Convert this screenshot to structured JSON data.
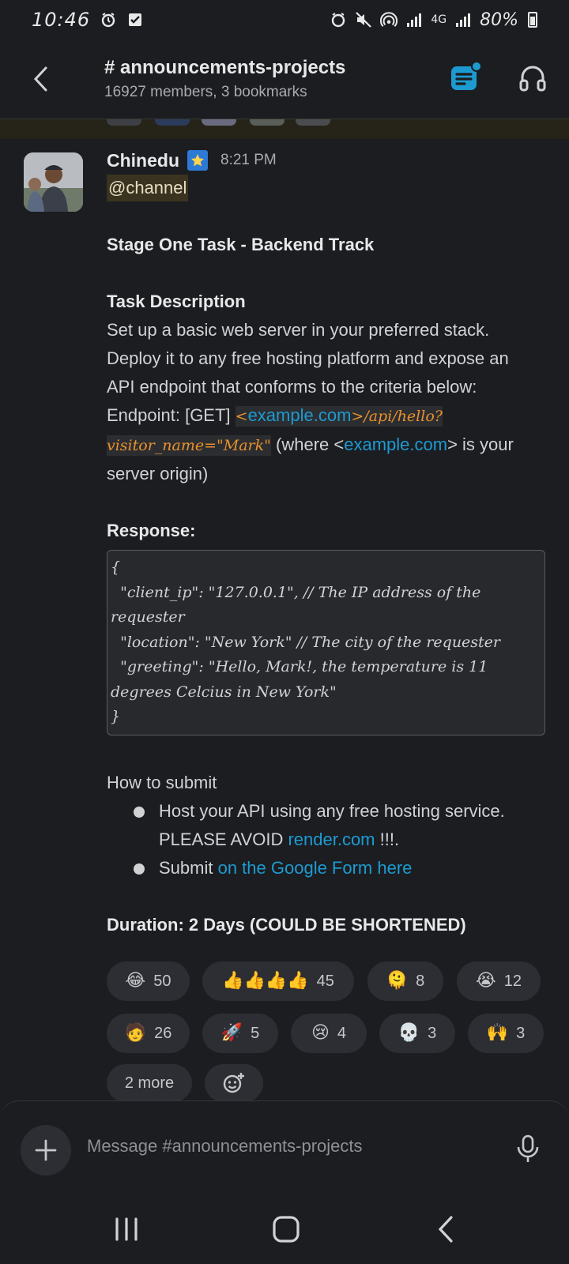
{
  "status_bar": {
    "time": "10:46",
    "battery": "80%",
    "network": "4G"
  },
  "header": {
    "title": "# announcements-projects",
    "subtitle": "16927 members, 3 bookmarks"
  },
  "message": {
    "author": "Chinedu",
    "time": "8:21 PM",
    "mention": "@channel",
    "heading": "Stage One Task - Backend Track",
    "task_title": "Task Description",
    "task_lines": [
      "Set up a basic web server in your preferred stack.",
      "Deploy it to any free hosting platform and expose an",
      "API endpoint that conforms to the criteria below:"
    ],
    "endpoint_prefix": "Endpoint: [GET] ",
    "endpoint_lt": "<",
    "endpoint_link": "example.com",
    "endpoint_path": ">/api/hello?",
    "endpoint_query": "visitor_name=\"Mark\"",
    "endpoint_note_pre": " (where <",
    "endpoint_note_link": "example.com",
    "endpoint_note_post": "> is your",
    "endpoint_note_end": "server origin)",
    "response_title": "Response:",
    "response_code": "{\n  \"client_ip\": \"127.0.0.1\", // The IP address of the requester\n  \"location\": \"New York\" // The city of the requester\n  \"greeting\": \"Hello, Mark!, the temperature is 11 degrees Celcius in New York\"\n}",
    "submit_title": "How to submit",
    "bullet1_text": "Host your API using any free hosting service. PLEASE AVOID ",
    "bullet1_link": "render.com",
    "bullet1_end": " !!!.",
    "bullet2_text": "Submit ",
    "bullet2_link": "on the Google Form here",
    "duration": "Duration: 2 Days (COULD BE SHORTENED)"
  },
  "reactions": [
    {
      "emoji": "😂",
      "count": "50"
    },
    {
      "emoji": "👍👍👍👍",
      "count": "45"
    },
    {
      "emoji": "🫠",
      "count": "8"
    },
    {
      "emoji": "😭",
      "count": "12"
    },
    {
      "emoji": "🧑",
      "count": "26"
    },
    {
      "emoji": "🚀",
      "count": "5"
    },
    {
      "emoji": "😢",
      "count": "4"
    },
    {
      "emoji": "💀",
      "count": "3"
    },
    {
      "emoji": "🙌",
      "count": "3"
    }
  ],
  "more_reactions": "2 more",
  "composer": {
    "placeholder": "Message #announcements-projects"
  },
  "colors": {
    "background": "#1b1d21",
    "link": "#1d9bd1",
    "code": "#e8912d",
    "canvas_icon": "#1d9bd1",
    "notification_dot": "#1d9bd1"
  }
}
